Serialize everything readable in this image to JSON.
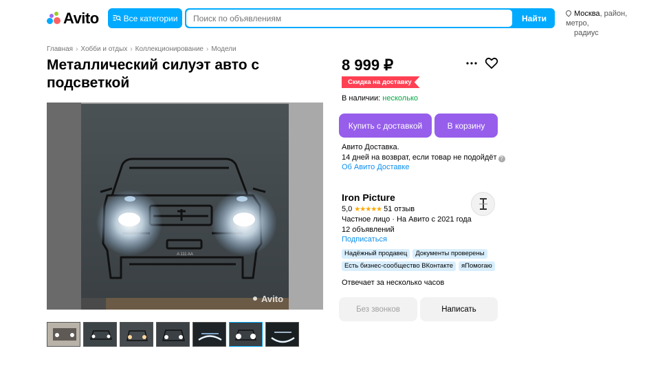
{
  "header": {
    "logo_text": "Avito",
    "categories_label": "Все категории",
    "search_placeholder": "Поиск по объявлениям",
    "search_button": "Найти",
    "location_city": "Москва",
    "location_rest": ", район, метро,",
    "location_radius": "радиус"
  },
  "breadcrumb": [
    "Главная",
    "Хобби и отдых",
    "Коллекционирование",
    "Модели"
  ],
  "listing": {
    "title": "Металлический силуэт авто с подсветкой",
    "price": "8 999 ₽",
    "discount_badge": "Скидка на доставку",
    "stock_label": "В наличии:",
    "stock_value": "несколько",
    "watermark": "Avito",
    "plate_text": "A 111 AA"
  },
  "actions": {
    "buy_label": "Купить с доставкой",
    "cart_label": "В корзину"
  },
  "delivery": {
    "line1": "Авито Доставка.",
    "line2": "14 дней на возврат, если товар не подойдёт",
    "link": "Об Авито Доставке"
  },
  "seller": {
    "name": "Iron Picture",
    "avatar_letter": "I",
    "rating": "5,0",
    "stars": "★★★★★",
    "reviews": "51 отзыв",
    "type_since": "Частное лицо · На Авито с 2021 года",
    "ads_count": "12 объявлений",
    "subscribe": "Подписаться",
    "badges": [
      "Надёжный продавец",
      "Документы проверены",
      "Есть бизнес-сообщество ВКонтакте",
      "яПомогаю"
    ],
    "response_time": "Отвечает за несколько часов",
    "no_calls_label": "Без звонков",
    "write_label": "Написать"
  },
  "thumbnails_count": 7,
  "active_thumbnail_index": 5,
  "colors": {
    "brand_blue": "#00aaff",
    "purple_button": "#965eeb",
    "discount_red": "#ff4053",
    "stock_green": "#02a942",
    "link_blue": "#0a8ff0"
  }
}
